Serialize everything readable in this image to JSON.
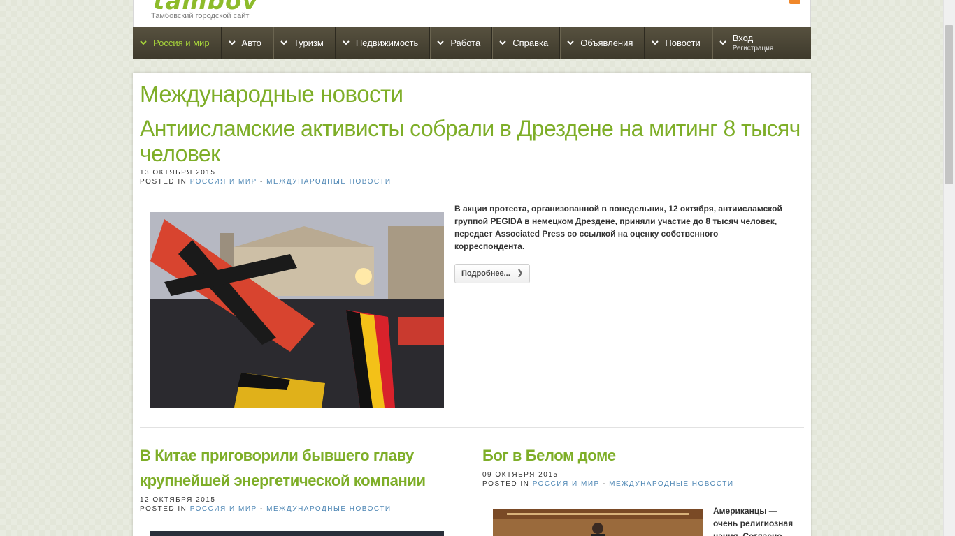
{
  "site": {
    "logo_text": "tambov",
    "tagline": "Тамбовский городской сайт"
  },
  "nav": {
    "items": [
      {
        "label": "Россия и мир",
        "active": true
      },
      {
        "label": "Авто"
      },
      {
        "label": "Туризм"
      },
      {
        "label": "Недвижимость"
      },
      {
        "label": "Работа"
      },
      {
        "label": "Справка"
      },
      {
        "label": "Объявления"
      },
      {
        "label": "Новости"
      }
    ],
    "login": {
      "label": "Вход",
      "sub": "Регистрация"
    }
  },
  "main": {
    "section_title": "Международные новости",
    "featured": {
      "title": "Антиисламские активисты собрали в Дрездене на митинг 8 тысяч человек",
      "date": "13 ОКТЯБРЯ 2015",
      "posted_in": "POSTED IN",
      "cat1": "РОССИЯ И МИР",
      "sep": "-",
      "cat2": "МЕЖДУНАРОДНЫЕ НОВОСТИ",
      "excerpt": "В акции протеста, организованной в понедельник, 12 октября, антиисламской группой PEGIDA в немецком Дрездене, приняли участие до 8 тысяч человек, передает Associated Press со ссылкой на оценку собственного корреспондента.",
      "more_label": "Подробнее..."
    },
    "articles": [
      {
        "title": "В Китае приговорили бывшего главу крупнейшей энергетической компании",
        "date": "12 ОКТЯБРЯ 2015",
        "posted_in": "POSTED IN",
        "cat1": "РОССИЯ И МИР",
        "sep": "-",
        "cat2": "МЕЖДУНАРОДНЫЕ НОВОСТИ"
      },
      {
        "title": "Бог в Белом доме",
        "date": "09 ОКТЯБРЯ 2015",
        "posted_in": "POSTED IN",
        "cat1": "РОССИЯ И МИР",
        "sep": "-",
        "cat2": "МЕЖДУНАРОДНЫЕ НОВОСТИ",
        "excerpt": "Американцы — очень религиозная нация. Согласно опросам"
      }
    ]
  },
  "colors": {
    "accent": "#7eae28",
    "nav_bg": "#4a4535",
    "link": "#4d86b4"
  }
}
